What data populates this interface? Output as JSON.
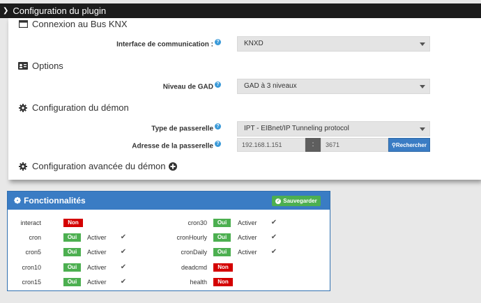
{
  "window": {
    "title": "Configuration du plugin"
  },
  "sections": {
    "knx": {
      "title": "Connexion au Bus KNX",
      "interface_label": "Interface de communication :",
      "interface_value": "KNXD"
    },
    "options": {
      "title": "Options",
      "gad_label": "Niveau de GAD",
      "gad_value": "GAD à 3 niveaux"
    },
    "daemon": {
      "title": "Configuration du démon",
      "gateway_type_label": "Type de passerelle",
      "gateway_type_value": "IPT - EIBnet/IP Tunneling protocol",
      "gateway_address_label": "Adresse de la passerelle",
      "ip_value": "192.168.1.151",
      "separator": ":",
      "port_value": "3671",
      "search_label": "Rechercher"
    },
    "advanced": {
      "title": "Configuration avancée du démon"
    }
  },
  "features": {
    "title": "Fonctionnalités",
    "save_label": "Sauvegarder",
    "activate_label": "Activer",
    "yes_label": "Oui",
    "no_label": "Non",
    "left": [
      {
        "name": "interact",
        "state": "Non",
        "activate": false
      },
      {
        "name": "cron",
        "state": "Oui",
        "activate": true,
        "checked": true
      },
      {
        "name": "cron5",
        "state": "Oui",
        "activate": true,
        "checked": true
      },
      {
        "name": "cron10",
        "state": "Oui",
        "activate": true,
        "checked": true
      },
      {
        "name": "cron15",
        "state": "Oui",
        "activate": true,
        "checked": true
      }
    ],
    "right": [
      {
        "name": "cron30",
        "state": "Oui",
        "activate": true,
        "checked": true
      },
      {
        "name": "cronHourly",
        "state": "Oui",
        "activate": true,
        "checked": true
      },
      {
        "name": "cronDaily",
        "state": "Oui",
        "activate": true,
        "checked": true
      },
      {
        "name": "deadcmd",
        "state": "Non",
        "activate": false
      },
      {
        "name": "health",
        "state": "Non",
        "activate": false
      }
    ]
  },
  "colors": {
    "accent": "#3a7cc4",
    "ok": "#4caf50",
    "danger": "#d40000",
    "help": "#3a9ad9"
  }
}
